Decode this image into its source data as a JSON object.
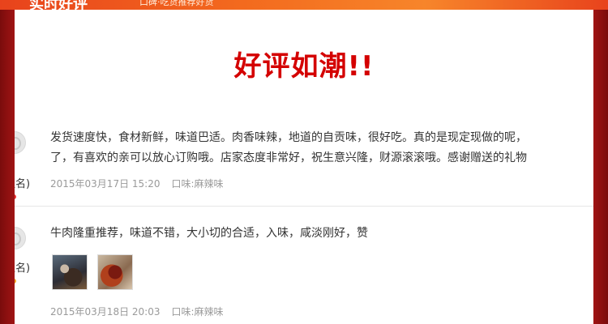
{
  "banner": {
    "title": "实时好评",
    "subtitle": "口碑·吃货推荐好货"
  },
  "headline": "好评如潮!!",
  "reviews": [
    {
      "username": "匿名)",
      "content_line1": "发货速度快，食材新鲜，味道巴适。肉香味辣，地道的自贡味，很好吃。真的是现定现做的呢，",
      "content_line2": "了，有喜欢的亲可以放心订购哦。店家态度非常好，祝生意兴隆，财源滚滚哦。感谢赠送的礼物",
      "date": "2015年03月17日 15:20",
      "flavor": "口味:麻辣味"
    },
    {
      "username": "匿名)",
      "content_line1": "牛肉隆重推荐，味道不错，大小切的合适，入味，咸淡刚好，赞",
      "date": "2015年03月18日 20:03",
      "flavor": "口味:麻辣味",
      "photos": [
        "review-photo-1",
        "review-photo-2"
      ]
    }
  ],
  "colors": {
    "frame": "#8a1010",
    "banner": "#f36a1e",
    "headline": "#d40000",
    "meta": "#9a9a9a"
  }
}
